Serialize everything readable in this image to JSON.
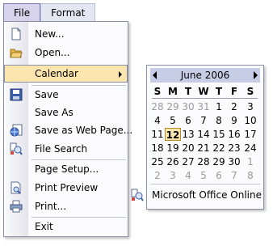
{
  "menubar": {
    "items": [
      {
        "label": "File"
      },
      {
        "label": "Format"
      }
    ]
  },
  "file_menu": {
    "items": [
      {
        "label": "New...",
        "icon": "new-document-icon"
      },
      {
        "label": "Open...",
        "icon": "open-folder-icon"
      },
      {
        "label": "Calendar",
        "submenu": true
      },
      {
        "label": "Save",
        "icon": "save-icon"
      },
      {
        "label": "Save As"
      },
      {
        "label": "Save as Web Page...",
        "icon": "web-page-icon"
      },
      {
        "label": "File Search",
        "icon": "file-search-icon"
      },
      {
        "label": "Page Setup..."
      },
      {
        "label": "Print Preview",
        "icon": "print-preview-icon"
      },
      {
        "label": "Print...",
        "icon": "printer-icon"
      },
      {
        "label": "Exit"
      }
    ]
  },
  "calendar": {
    "month": "June 2006",
    "weekdays": [
      "S",
      "M",
      "T",
      "W",
      "T",
      "F",
      "S"
    ],
    "weeks": [
      [
        "28",
        "29",
        "30",
        "31",
        "1",
        "2",
        "3"
      ],
      [
        "4",
        "5",
        "6",
        "7",
        "8",
        "9",
        "10"
      ],
      [
        "11",
        "12",
        "13",
        "14",
        "15",
        "16",
        "17"
      ],
      [
        "18",
        "19",
        "20",
        "21",
        "22",
        "23",
        "24"
      ],
      [
        "25",
        "26",
        "27",
        "28",
        "29",
        "30",
        "1"
      ],
      [
        "2",
        "3",
        "4",
        "5",
        "6",
        "7",
        "8"
      ]
    ],
    "selected": "12",
    "footer_label": "Microsoft Office Online"
  }
}
